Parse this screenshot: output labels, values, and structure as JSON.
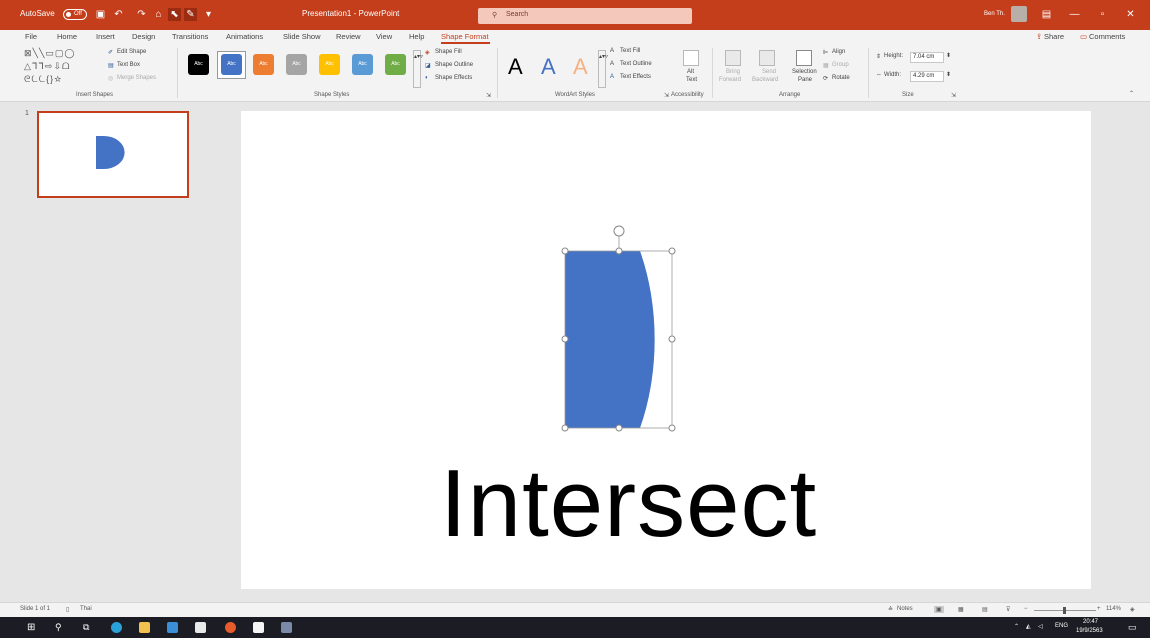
{
  "titlebar": {
    "autosave_label": "AutoSave",
    "autosave_state": "Off",
    "document_title": "Presentation1 - PowerPoint",
    "search_placeholder": "Search",
    "user_name": "Ben Th.",
    "minimize": "—",
    "restore": "▫",
    "close": "✕"
  },
  "tabs": [
    "File",
    "Home",
    "Insert",
    "Design",
    "Transitions",
    "Animations",
    "Slide Show",
    "Review",
    "View",
    "Help",
    "Shape Format"
  ],
  "share": {
    "share_label": "Share",
    "comments_label": "Comments"
  },
  "ribbon": {
    "insert_shapes": {
      "label": "Insert Shapes",
      "edit_shape": "Edit Shape",
      "text_box": "Text Box",
      "merge_shapes": "Merge Shapes",
      "glyph_row1": "⊠╲╲▭▢◯",
      "glyph_row2": "△ᒣᒣ⇨⇩ᗝ",
      "glyph_row3": "ᘓᘇᘇ{}☆"
    },
    "shape_styles": {
      "label": "Shape Styles",
      "swatch_text": "Abc",
      "swatches": [
        "#000000",
        "#4472c4",
        "#ed7d31",
        "#a5a5a5",
        "#ffc000",
        "#5b9bd5",
        "#70ad47"
      ],
      "shape_fill": "Shape Fill",
      "shape_outline": "Shape Outline",
      "shape_effects": "Shape Effects"
    },
    "wordart_styles": {
      "label": "WordArt Styles",
      "letters": [
        "A",
        "A",
        "A"
      ],
      "colors": [
        "#000000",
        "#4472c4",
        "#f4b183"
      ],
      "text_fill": "Text Fill",
      "text_outline": "Text Outline",
      "text_effects": "Text Effects"
    },
    "accessibility": {
      "label": "Accessibility",
      "alt_text_1": "Alt",
      "alt_text_2": "Text"
    },
    "arrange": {
      "label": "Arrange",
      "bring_forward_1": "Bring",
      "bring_forward_2": "Forward",
      "send_backward_1": "Send",
      "send_backward_2": "Backward",
      "selection_pane_1": "Selection",
      "selection_pane_2": "Pane",
      "align": "Align",
      "group": "Group",
      "rotate": "Rotate"
    },
    "size": {
      "label": "Size",
      "height_label": "Height:",
      "height_value": "7.04 cm",
      "width_label": "Width:",
      "width_value": "4.29 cm"
    }
  },
  "thumbnail": {
    "number": "1"
  },
  "slide": {
    "title": "Intersect",
    "shape_color": "#4472c4"
  },
  "statusbar": {
    "slide_info": "Slide 1 of 1",
    "language": "Thai",
    "notes": "Notes",
    "zoom": "114%"
  },
  "taskbar": {
    "language": "ENG",
    "time": "20:47",
    "date": "19/9/2563"
  },
  "colors": {
    "accent": "#c43e1c",
    "shape": "#4472c4"
  }
}
